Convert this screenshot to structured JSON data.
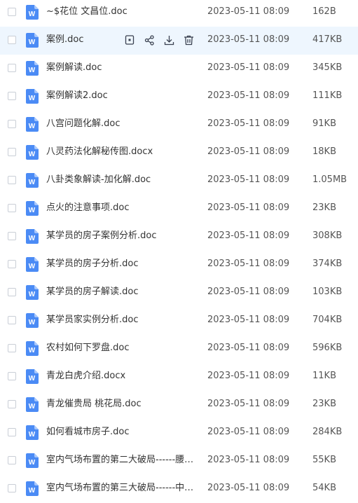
{
  "colors": {
    "doc_icon": "#4b8bf5",
    "hover_row": "#eef6fe",
    "action_icon": "#3a4150"
  },
  "file_icon": "word-doc-icon",
  "hover_actions": [
    "preview-icon",
    "share-icon",
    "download-icon",
    "delete-icon"
  ],
  "files": [
    {
      "name": "~$花位 文昌位.doc",
      "date": "2023-05-11 08:09",
      "size": "162B",
      "hover": false
    },
    {
      "name": "案例.doc",
      "date": "2023-05-11 08:09",
      "size": "417KB",
      "hover": true
    },
    {
      "name": "案例解读.doc",
      "date": "2023-05-11 08:09",
      "size": "345KB",
      "hover": false
    },
    {
      "name": "案例解读2.doc",
      "date": "2023-05-11 08:09",
      "size": "111KB",
      "hover": false
    },
    {
      "name": "八宫问题化解.doc",
      "date": "2023-05-11 08:09",
      "size": "91KB",
      "hover": false
    },
    {
      "name": "八灵药法化解秘传图.docx",
      "date": "2023-05-11 08:09",
      "size": "18KB",
      "hover": false
    },
    {
      "name": "八卦类象解读-加化解.doc",
      "date": "2023-05-11 08:09",
      "size": "1.05MB",
      "hover": false
    },
    {
      "name": "点火的注意事项.doc",
      "date": "2023-05-11 08:09",
      "size": "23KB",
      "hover": false
    },
    {
      "name": "某学员的房子案例分析.doc",
      "date": "2023-05-11 08:09",
      "size": "308KB",
      "hover": false
    },
    {
      "name": "某学员的房子分析.doc",
      "date": "2023-05-11 08:09",
      "size": "374KB",
      "hover": false
    },
    {
      "name": "某学员的房子解读.doc",
      "date": "2023-05-11 08:09",
      "size": "103KB",
      "hover": false
    },
    {
      "name": "某学员家实例分析.doc",
      "date": "2023-05-11 08:09",
      "size": "704KB",
      "hover": false
    },
    {
      "name": "农村如何下罗盘.doc",
      "date": "2023-05-11 08:09",
      "size": "596KB",
      "hover": false
    },
    {
      "name": "青龙白虎介绍.docx",
      "date": "2023-05-11 08:09",
      "size": "11KB",
      "hover": false
    },
    {
      "name": "青龙催贵局 桃花局.doc",
      "date": "2023-05-11 08:09",
      "size": "23KB",
      "hover": false
    },
    {
      "name": "如何看城市房子.doc",
      "date": "2023-05-11 08:09",
      "size": "284KB",
      "hover": false
    },
    {
      "name": "室内气场布置的第二大破局------腰肋...",
      "date": "2023-05-11 08:09",
      "size": "55KB",
      "hover": false
    },
    {
      "name": "室内气场布置的第三大破局------中宫...",
      "date": "2023-05-11 08:09",
      "size": "54KB",
      "hover": false
    }
  ]
}
